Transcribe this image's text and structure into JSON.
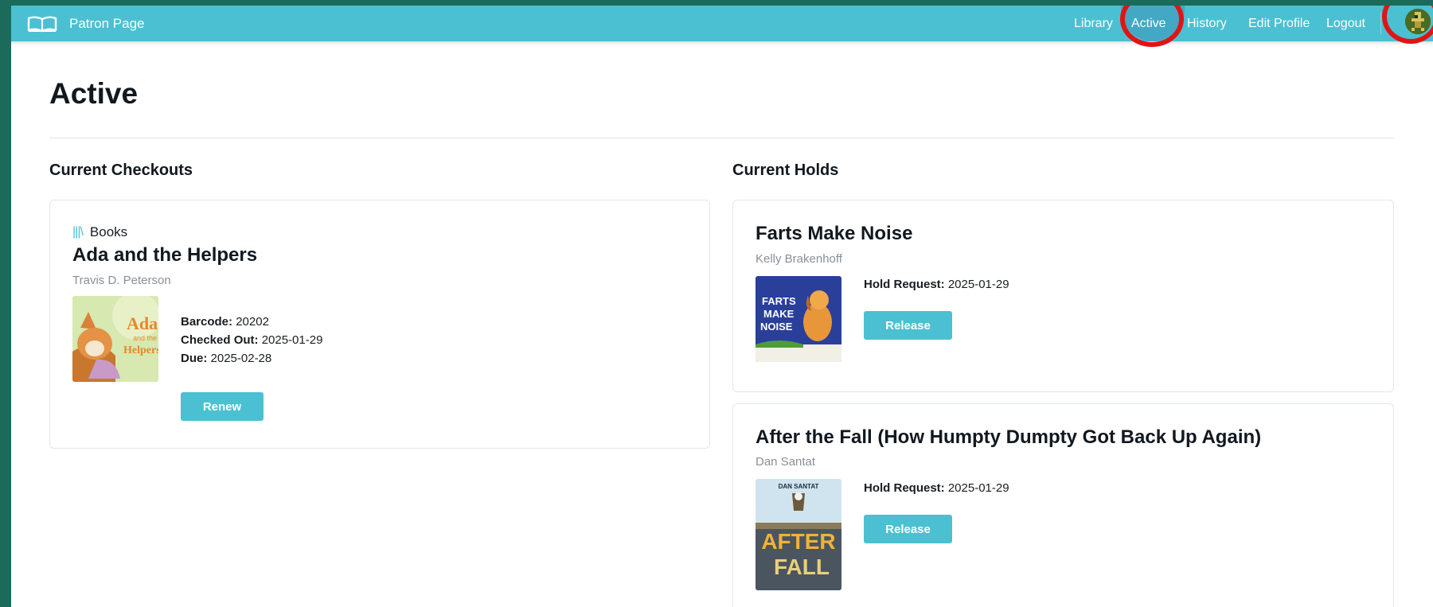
{
  "nav": {
    "brand": "Patron Page",
    "links": [
      "Library",
      "Active",
      "History",
      "Edit Profile",
      "Logout"
    ],
    "active_link": "Active"
  },
  "page": {
    "title": "Active"
  },
  "checkouts": {
    "heading": "Current Checkouts",
    "items": [
      {
        "category": "Books",
        "title": "Ada and the Helpers",
        "author": "Travis D. Peterson",
        "barcode_label": "Barcode:",
        "barcode": "20202",
        "checked_out_label": "Checked Out:",
        "checked_out": "2025-01-29",
        "due_label": "Due:",
        "due": "2025-02-28",
        "action": "Renew",
        "cover_text": [
          "Ada",
          "and the",
          "Helpers"
        ]
      }
    ]
  },
  "holds": {
    "heading": "Current Holds",
    "items": [
      {
        "title": "Farts Make Noise",
        "author": "Kelly Brakenhoff",
        "hold_label": "Hold Request:",
        "hold_date": "2025-01-29",
        "action": "Release",
        "cover_text": [
          "FARTS",
          "MAKE",
          "NOISE"
        ]
      },
      {
        "title": "After the Fall (How Humpty Dumpty Got Back Up Again)",
        "author": "Dan Santat",
        "hold_label": "Hold Request:",
        "hold_date": "2025-01-29",
        "action": "Release",
        "cover_text": [
          "DAN SANTAT",
          "AFTER",
          "FALL"
        ]
      }
    ]
  },
  "colors": {
    "accent": "#4bc0d2",
    "annotation_ring": "#e11414",
    "background": "#1c6b5a"
  }
}
